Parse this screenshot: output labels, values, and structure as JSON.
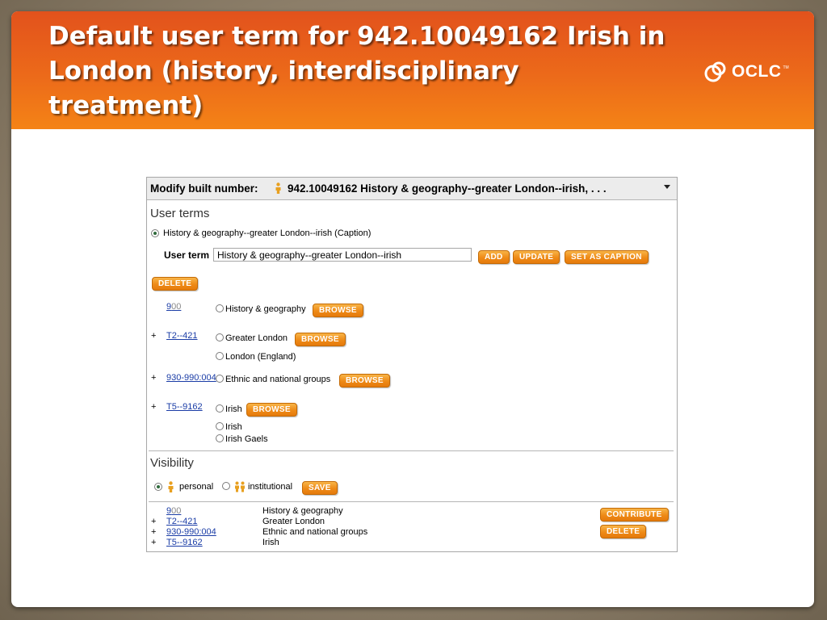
{
  "slide": {
    "title": "Default user term for 942.10049162 Irish in London (history, interdisciplinary treatment)",
    "logo_text": "OCLC",
    "logo_tm": "TM"
  },
  "panel": {
    "header_label": "Modify built number:",
    "header_value": "942.10049162 History & geography--greater London--irish, . . .",
    "user_terms": {
      "heading": "User terms",
      "selected_term": "History & geography--greater London--irish  (Caption)",
      "field_label": "User term",
      "field_value": "History & geography--greater London--irish",
      "add_label": "ADD",
      "update_label": "UPDATE",
      "set_caption_label": "SET AS CAPTION",
      "delete_label": "DELETE"
    },
    "components": [
      {
        "prefix": "",
        "link_main": "9",
        "link_rest": "00",
        "terms": [
          "History & geography"
        ],
        "browse": "BROWSE"
      },
      {
        "prefix": "+",
        "link_main": "T2--421",
        "link_rest": "",
        "terms": [
          "Greater London",
          "London (England)"
        ],
        "browse": "BROWSE"
      },
      {
        "prefix": "+",
        "link_main": "930-990:004",
        "link_rest": "",
        "terms": [
          "Ethnic and national groups"
        ],
        "browse": "BROWSE"
      },
      {
        "prefix": "+",
        "link_main": "T5--9162",
        "link_rest": "",
        "terms": [
          "Irish",
          "Irish",
          "Irish Gaels"
        ],
        "browse": "BROWSE"
      }
    ],
    "visibility": {
      "heading": "Visibility",
      "personal": "personal",
      "institutional": "institutional",
      "save_label": "SAVE"
    },
    "summary": {
      "rows": [
        {
          "prefix": "",
          "link_main": "9",
          "link_rest": "00",
          "label": "History & geography"
        },
        {
          "prefix": "+",
          "link_main": "T2--421",
          "link_rest": "",
          "label": "Greater London"
        },
        {
          "prefix": "+",
          "link_main": "930-990:004",
          "link_rest": "",
          "label": "Ethnic and national groups"
        },
        {
          "prefix": "+",
          "link_main": "T5--9162",
          "link_rest": "",
          "label": "Irish"
        }
      ],
      "contribute_label": "CONTRIBUTE",
      "delete_label": "DELETE"
    }
  },
  "colors": {
    "banner": "#ec6a1a",
    "button": "#ee8a17",
    "link": "#1a3ca6"
  }
}
